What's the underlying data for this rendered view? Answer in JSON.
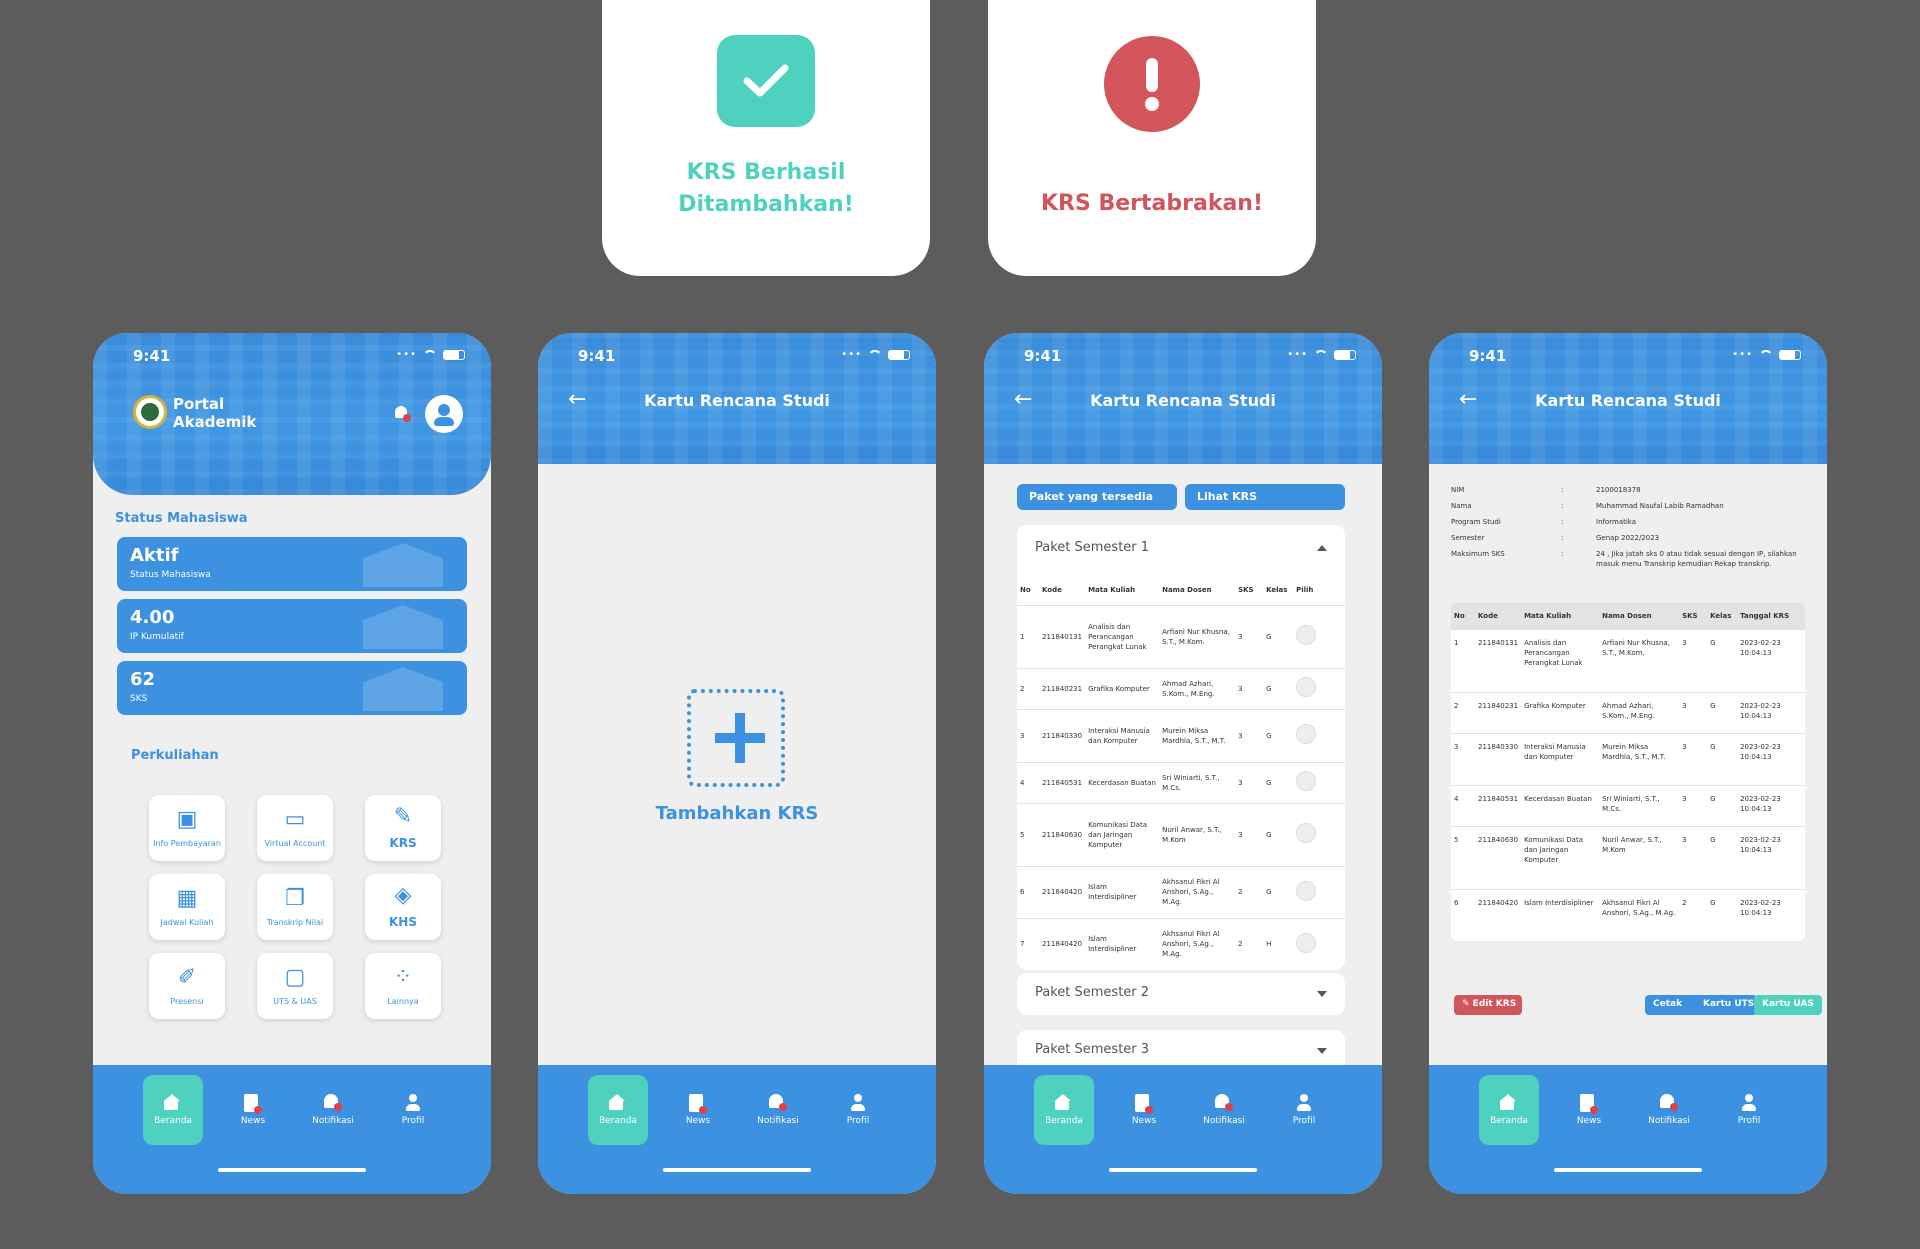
{
  "dialogs": {
    "success": {
      "text": "KRS Berhasil Ditambahkan!"
    },
    "error": {
      "text": "KRS Bertabrakan!"
    }
  },
  "status_bar": {
    "time": "9:41"
  },
  "bottom_nav": [
    "Beranda",
    "News",
    "Notifikasi",
    "Profil"
  ],
  "home": {
    "portal_title": "Portal Akademik",
    "status_section": "Status Mahasiswa",
    "stats": [
      {
        "value": "Aktif",
        "label": "Status Mahasiswa"
      },
      {
        "value": "4.00",
        "label": "IP Kumulatif"
      },
      {
        "value": "62",
        "label": "SKS"
      }
    ],
    "perkuliahan_section": "Perkuliahan",
    "menu": [
      {
        "label": "Info Pembayaran",
        "icon": "wallet-icon"
      },
      {
        "label": "Virtual Account",
        "icon": "card-icon"
      },
      {
        "label": "KRS",
        "icon": "pen-icon"
      },
      {
        "label": "Jadwal Kuliah",
        "icon": "calendar-icon"
      },
      {
        "label": "Transkrip Nilai",
        "icon": "documents-icon"
      },
      {
        "label": "KHS",
        "icon": "graduation-cap-icon"
      },
      {
        "label": "Presensi",
        "icon": "edit-icon"
      },
      {
        "label": "UTS & UAS",
        "icon": "clipboard-icon"
      },
      {
        "label": "Lainnya",
        "icon": "grid-icon"
      }
    ]
  },
  "krs_page": {
    "title": "Kartu Rencana Studi",
    "add_label": "Tambahkan KRS"
  },
  "paket_page": {
    "tabs": [
      "Paket yang tersedia",
      "Lihat KRS"
    ],
    "paket1_title": "Paket Semester 1",
    "paket2_title": "Paket Semester 2",
    "paket3_title": "Paket Semester 3",
    "columns": [
      "No",
      "Kode",
      "Mata Kuliah",
      "Nama Dosen",
      "SKS",
      "Kelas",
      "Pilih"
    ],
    "rows": [
      [
        "1",
        "211840131",
        "Analisis dan Perancangan Perangkat Lunak",
        "Arfiani Nur Khusna, S.T., M.Kom.",
        "3",
        "G"
      ],
      [
        "2",
        "211840231",
        "Grafika Komputer",
        "Ahmad Azhari, S.Kom., M.Eng.",
        "3",
        "G"
      ],
      [
        "3",
        "211840330",
        "Interaksi Manusia dan Komputer",
        "Murein Miksa Mardhia, S.T., M.T.",
        "3",
        "G"
      ],
      [
        "4",
        "211840531",
        "Kecerdasan Buatan",
        "Sri Winiarti, S.T., M.Cs.",
        "3",
        "G"
      ],
      [
        "5",
        "211840630",
        "Komunikasi Data dan Jaringan Komputer",
        "Nuril Anwar, S.T., M.Kom",
        "3",
        "G"
      ],
      [
        "6",
        "211840420",
        "Islam Interdisipliner",
        "Akhsanul Fikri Al Anshori, S.Ag., M.Ag.",
        "2",
        "G"
      ],
      [
        "7",
        "211840420",
        "Islam Interdisipliner",
        "Akhsanul Fikri Al Anshori, S.Ag., M.Ag.",
        "2",
        "H"
      ]
    ]
  },
  "lihat_page": {
    "info": [
      {
        "key": "NIM",
        "value": "2100018378"
      },
      {
        "key": "Nama",
        "value": "Muhammad Naufal Labib Ramadhan"
      },
      {
        "key": "Program Studi",
        "value": "Informatika"
      },
      {
        "key": "Semester",
        "value": "Genap 2022/2023"
      },
      {
        "key": "Maksimum SKS",
        "value": "24 , Jika jatah sks 0 atau tidak sesuai dengan IP, silahkan masuk menu Transkrip kemudian Rekap transkrip."
      }
    ],
    "columns": [
      "No",
      "Kode",
      "Mata Kuliah",
      "Nama Dosen",
      "SKS",
      "Kelas",
      "Tanggal KRS"
    ],
    "rows": [
      [
        "1",
        "211840131",
        "Analisis dan Perancangan Perangkat Lunak",
        "Arfiani Nur Khusna, S.T., M.Kom.",
        "3",
        "G",
        "2023-02-23 10:04:13"
      ],
      [
        "2",
        "211840231",
        "Grafika Komputer",
        "Ahmad Azhari, S.Kom., M.Eng.",
        "3",
        "G",
        "2023-02-23 10:04:13"
      ],
      [
        "3",
        "211840330",
        "Interaksi Manusia dan Komputer",
        "Murein Miksa Mardhia, S.T., M.T.",
        "3",
        "G",
        "2023-02-23 10:04:13"
      ],
      [
        "4",
        "211840531",
        "Kecerdasan Buatan",
        "Sri Winiarti, S.T., M.Cs.",
        "3",
        "G",
        "2023-02-23 10:04:13"
      ],
      [
        "5",
        "211840630",
        "Komunikasi Data dan Jaringan Komputer",
        "Nuril Anwar, S.T., M.Kom",
        "3",
        "G",
        "2023-02-23 10:04:13"
      ],
      [
        "6",
        "211840420",
        "Islam Interdisipliner",
        "Akhsanul Fikri Al Anshori, S.Ag., M.Ag.",
        "2",
        "G",
        "2023-02-23 10:04:13"
      ]
    ],
    "buttons": {
      "edit": "✎ Edit KRS",
      "cetak": "Cetak",
      "kartu_uts": "Kartu UTS",
      "kartu_uas": "Kartu UAS"
    }
  },
  "colors": {
    "primary": "#3c92e0",
    "accent": "#4fd1c0",
    "danger": "#d2555c"
  }
}
